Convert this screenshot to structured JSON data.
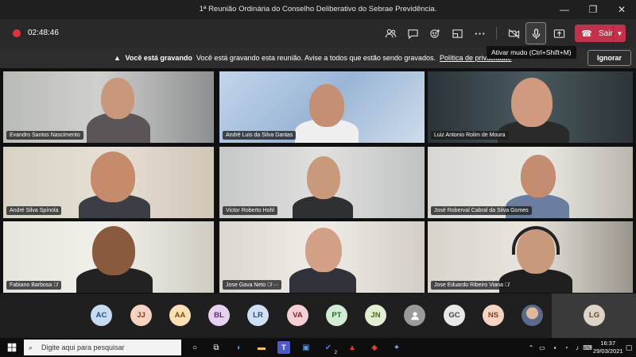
{
  "window": {
    "title": "1ª Reunião Ordinária do Conselho Deliberativo do Sebrae Previdência."
  },
  "toolbar": {
    "timer": "02:48:46",
    "leave_label": "Sair",
    "icons": [
      "participants-icon",
      "chat-icon",
      "reactions-icon",
      "rooms-icon",
      "more-icon",
      "camera-off-icon",
      "microphone-icon",
      "share-icon"
    ]
  },
  "banner": {
    "bold_text": "Você está gravando",
    "message": "Você está gravando esta reunião. Avise a todos que estão sendo gravados.",
    "link": "Política de privacidade",
    "ignore_label": "Ignorar"
  },
  "tooltip": {
    "text": "Ativar mudo (Ctrl+Shift+M)"
  },
  "participants": [
    {
      "name": "Evandro Santos Nascimento"
    },
    {
      "name": "André Luis da Silva Dantas"
    },
    {
      "name": "Luiz Antonio Rolim de Moura"
    },
    {
      "name": "André Silva Spínola"
    },
    {
      "name": "Victor Roberto Hohl"
    },
    {
      "name": "José Roberval Cabral da Silva Gomes"
    },
    {
      "name": "Fabiano Barbosa"
    },
    {
      "name": "Jose Gava Neto"
    },
    {
      "name": "Jose Eduardo Ribeiro Viana"
    }
  ],
  "avatars": [
    {
      "initials": "AC",
      "bg": "#c7dcf0",
      "fg": "#1f4e79"
    },
    {
      "initials": "JJ",
      "bg": "#f6d3c2",
      "fg": "#8a3b1a"
    },
    {
      "initials": "AA",
      "bg": "#f9e0b5",
      "fg": "#7a4a00"
    },
    {
      "initials": "BL",
      "bg": "#e6d1ee",
      "fg": "#5c2a74"
    },
    {
      "initials": "LR",
      "bg": "#cfe0f5",
      "fg": "#1f4e79"
    },
    {
      "initials": "VA",
      "bg": "#f4cfd3",
      "fg": "#8a1f2e"
    },
    {
      "initials": "PT",
      "bg": "#d3ecd4",
      "fg": "#1f6b2a"
    },
    {
      "initials": "JN",
      "bg": "#e1eed0",
      "fg": "#4a6b1a"
    },
    {
      "initials": "",
      "bg": "#9a9a9a",
      "fg": "#ffffff"
    },
    {
      "initials": "GC",
      "bg": "#e8e8e8",
      "fg": "#444444"
    },
    {
      "initials": "NS",
      "bg": "#f6d3c2",
      "fg": "#8a3b1a"
    },
    {
      "initials": "",
      "bg": "#c89a7c",
      "fg": "#ffffff"
    },
    {
      "initials": "LG",
      "bg": "#ddd3c6",
      "fg": "#5a4a32"
    }
  ],
  "taskbar": {
    "search_placeholder": "Digite aqui para pesquisar",
    "time": "16:37",
    "date": "29/03/2021",
    "badge": "2"
  }
}
